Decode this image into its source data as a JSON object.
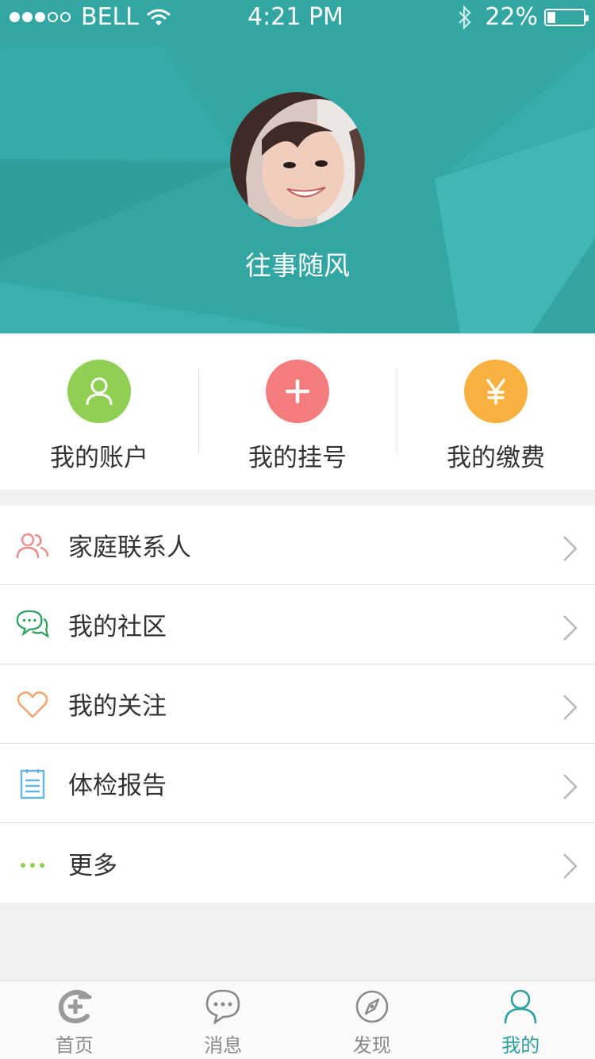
{
  "status_bar": {
    "carrier": "BELL",
    "time": "4:21 PM",
    "battery": "22%",
    "battery_level": 0.22
  },
  "profile": {
    "name": "往事随风"
  },
  "quick_actions": [
    {
      "label": "我的账户",
      "icon": "user-icon",
      "color": "#8fcf52"
    },
    {
      "label": "我的挂号",
      "icon": "plus-icon",
      "color": "#f47c7c"
    },
    {
      "label": "我的缴费",
      "icon": "yen-icon",
      "color": "#f8b13e"
    }
  ],
  "menu": [
    {
      "label": "家庭联系人",
      "icon": "family-icon",
      "color": "#f08a8a"
    },
    {
      "label": "我的社区",
      "icon": "chat-bubbles-icon",
      "color": "#2fa35f"
    },
    {
      "label": "我的关注",
      "icon": "heart-icon",
      "color": "#f4a26a"
    },
    {
      "label": "体检报告",
      "icon": "report-icon",
      "color": "#64b4e8"
    },
    {
      "label": "更多",
      "icon": "more-icon",
      "color": "#8fcf52"
    }
  ],
  "tabbar": [
    {
      "label": "首页",
      "icon": "home-logo-icon"
    },
    {
      "label": "消息",
      "icon": "message-icon"
    },
    {
      "label": "发现",
      "icon": "compass-icon"
    },
    {
      "label": "我的",
      "icon": "profile-icon",
      "active": true
    }
  ],
  "colors": {
    "header": "#31a6a3",
    "accent": "#2fa09d",
    "background": "#f1f1f1"
  }
}
